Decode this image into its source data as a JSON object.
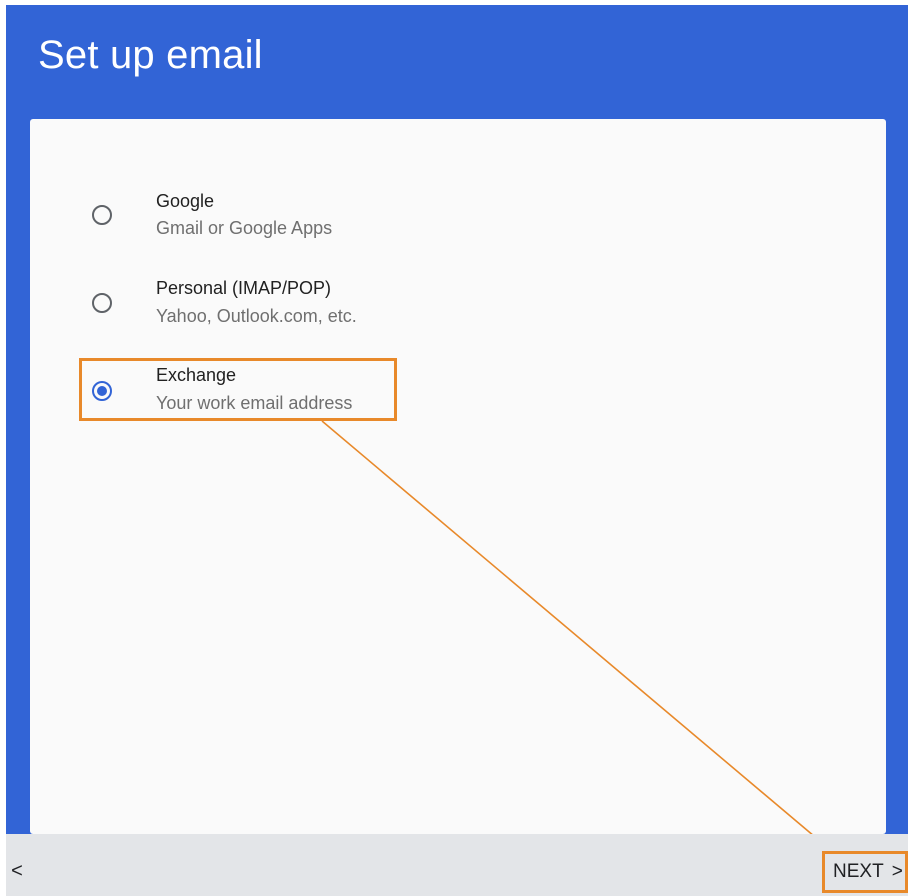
{
  "header": {
    "title": "Set up email"
  },
  "options": [
    {
      "title": "Google",
      "subtitle": "Gmail or Google Apps",
      "selected": false
    },
    {
      "title": "Personal (IMAP/POP)",
      "subtitle": "Yahoo, Outlook.com, etc.",
      "selected": false
    },
    {
      "title": "Exchange",
      "subtitle": "Your work email address",
      "selected": true
    }
  ],
  "footer": {
    "back_glyph": "<",
    "next_label": "NEXT",
    "next_glyph": ">"
  },
  "colors": {
    "header_bg": "#3264d6",
    "card_bg": "#fafafa",
    "annotation": "#e8892a",
    "bottom_bar": "#e3e5e8",
    "radio_selected": "#3264d6"
  }
}
